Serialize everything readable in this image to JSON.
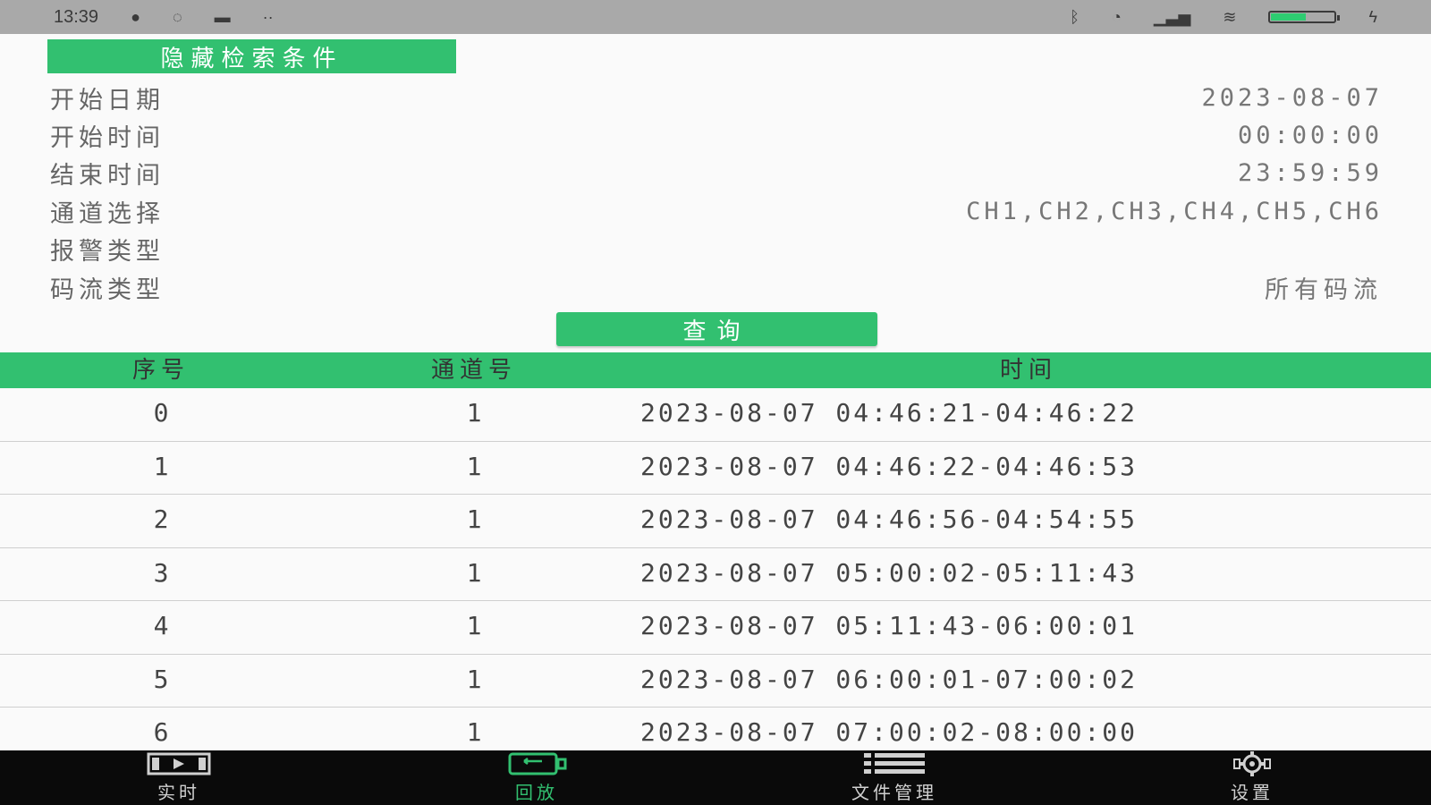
{
  "status_bar": {
    "time": "13:39",
    "left_icons": [
      "p-icon",
      "hd-icon",
      "message-icon",
      "dots-icon"
    ],
    "right_icons": [
      "bluetooth-icon",
      "alarm-icon",
      "signal-icon",
      "wifi-icon",
      "battery-icon",
      "charging-icon"
    ],
    "battery_level": 0.55,
    "colors": {
      "background": "#a9a9a9",
      "battery_fill": "#2ecc71"
    }
  },
  "search": {
    "toggle_label": "隐藏检索条件",
    "fields": [
      {
        "label": "开始日期",
        "value": "2023-08-07"
      },
      {
        "label": "开始时间",
        "value": "00:00:00"
      },
      {
        "label": "结束时间",
        "value": "23:59:59"
      },
      {
        "label": "通道选择",
        "value": "CH1,CH2,CH3,CH4,CH5,CH6"
      },
      {
        "label": "报警类型",
        "value": ""
      },
      {
        "label": "码流类型",
        "value": "所有码流"
      }
    ],
    "query_label": "查询"
  },
  "table": {
    "headers": {
      "index": "序号",
      "channel": "通道号",
      "time": "时间"
    },
    "rows": [
      {
        "index": "0",
        "channel": "1",
        "time": "2023-08-07 04:46:21-04:46:22"
      },
      {
        "index": "1",
        "channel": "1",
        "time": "2023-08-07 04:46:22-04:46:53"
      },
      {
        "index": "2",
        "channel": "1",
        "time": "2023-08-07 04:46:56-04:54:55"
      },
      {
        "index": "3",
        "channel": "1",
        "time": "2023-08-07 05:00:02-05:11:43"
      },
      {
        "index": "4",
        "channel": "1",
        "time": "2023-08-07 05:11:43-06:00:01"
      },
      {
        "index": "5",
        "channel": "1",
        "time": "2023-08-07 06:00:01-07:00:02"
      },
      {
        "index": "6",
        "channel": "1",
        "time": "2023-08-07 07:00:02-08:00:00"
      }
    ]
  },
  "nav": {
    "items": [
      {
        "label": "实时",
        "icon": "film-icon",
        "active": false
      },
      {
        "label": "回放",
        "icon": "playback-icon",
        "active": true
      },
      {
        "label": "文件管理",
        "icon": "list-icon",
        "active": false
      },
      {
        "label": "设置",
        "icon": "gear-icon",
        "active": false
      }
    ]
  },
  "colors": {
    "accent": "#32c070",
    "nav_background": "#0a0a0a",
    "nav_text": "#d0d0d0"
  }
}
